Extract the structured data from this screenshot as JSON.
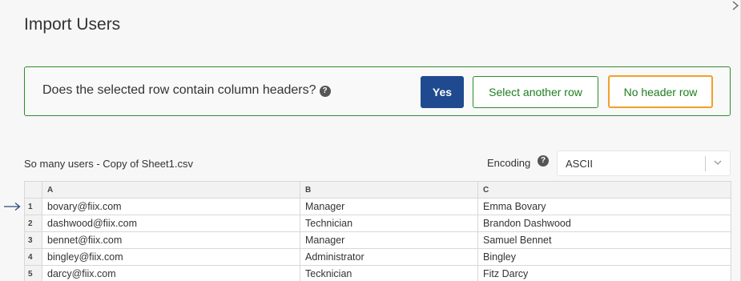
{
  "dialog": {
    "title": "Import Users",
    "close_icon": "close-icon"
  },
  "header_prompt": {
    "question": "Does the selected row contain column headers?",
    "help_icon": "?",
    "yes_label": "Yes",
    "select_other_label": "Select another row",
    "no_header_label": "No header row",
    "colors": {
      "primary": "#1f4a8f",
      "success": "#2e8b2e",
      "highlight": "#f0a12a"
    }
  },
  "file": {
    "name": "So many users - Copy of Sheet1.csv"
  },
  "encoding": {
    "label": "Encoding",
    "help_icon": "?",
    "selected": "ASCII"
  },
  "grid": {
    "columns": [
      "A",
      "B",
      "C"
    ],
    "rows": [
      {
        "num": "1",
        "cells": [
          "bovary@fiix.com",
          "Manager",
          "Emma Bovary"
        ]
      },
      {
        "num": "2",
        "cells": [
          "dashwood@fiix.com",
          "Technician",
          "Brandon Dashwood"
        ]
      },
      {
        "num": "3",
        "cells": [
          "bennet@fiix.com",
          "Manager",
          "Samuel Bennet"
        ]
      },
      {
        "num": "4",
        "cells": [
          "bingley@fiix.com",
          "Administrator",
          "Bingley"
        ]
      },
      {
        "num": "5",
        "cells": [
          "darcy@fiix.com",
          "Tecknician",
          "Fitz Darcy"
        ]
      }
    ],
    "selected_row": "1"
  }
}
